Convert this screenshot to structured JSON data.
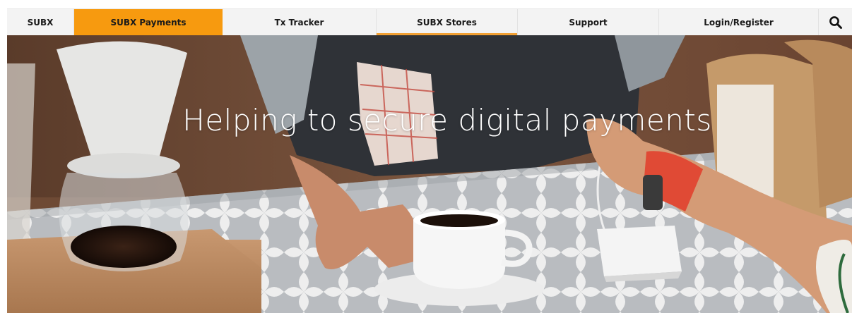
{
  "nav": {
    "items": [
      {
        "label": "SUBX",
        "state": "normal"
      },
      {
        "label": "SUBX Payments",
        "state": "active"
      },
      {
        "label": "Tx Tracker",
        "state": "normal"
      },
      {
        "label": "SUBX Stores",
        "state": "underlined"
      },
      {
        "label": "Support",
        "state": "normal"
      },
      {
        "label": "Login/Register",
        "state": "normal"
      }
    ],
    "search_icon": "search-icon"
  },
  "hero": {
    "title": "Helping to secure digital payments"
  },
  "colors": {
    "accent": "#f79a0f",
    "underline": "#f2a033",
    "nav_bg": "#f3f3f3"
  }
}
